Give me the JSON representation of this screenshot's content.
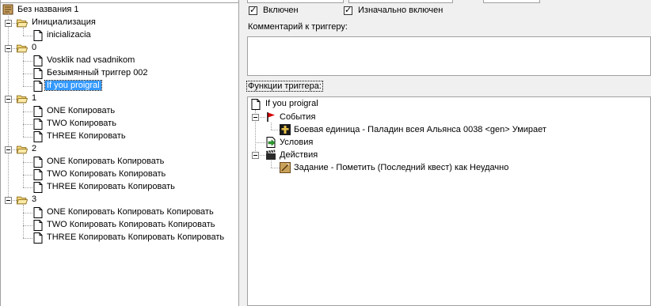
{
  "tree": {
    "root": "Без названия 1",
    "categories": [
      {
        "name": "Инициализация",
        "triggers": [
          "inicializacia"
        ]
      },
      {
        "name": "0",
        "triggers": [
          "Vosklik nad vsadnikom",
          "Безымянный триггер 002",
          "If you proigral"
        ]
      },
      {
        "name": "1",
        "triggers": [
          "ONE Копировать",
          "TWO Копировать",
          "THREE Копировать"
        ]
      },
      {
        "name": "2",
        "triggers": [
          "ONE Копировать Копировать",
          "TWO Копировать Копировать",
          "THREE Копировать Копировать"
        ]
      },
      {
        "name": "3",
        "triggers": [
          "ONE Копировать Копировать Копировать",
          "TWO Копировать Копировать Копировать",
          "THREE Копировать Копировать Копировать"
        ]
      }
    ],
    "selected": "If you proigral"
  },
  "options": {
    "enabled_label": "Включен",
    "enabled": true,
    "initially_on_label": "Изначально включен",
    "initially_on": true
  },
  "comment": {
    "label": "Комментарий к триггеру:",
    "value": ""
  },
  "functions": {
    "label": "Функции триггера:",
    "trigger_name": "If you proigral",
    "events_label": "События",
    "event_item": "Боевая единица - Паладин всея Альянса 0038 <gen> Умирает",
    "conditions_label": "Условия",
    "actions_label": "Действия",
    "action_item": "Задание - Пометить (Последний квест) как Неудачно"
  },
  "colors": {
    "selection": "#3399ff",
    "folder": "#f5d77a",
    "event_flag": "#d40000",
    "condition_arrow": "#2e9e2e"
  }
}
